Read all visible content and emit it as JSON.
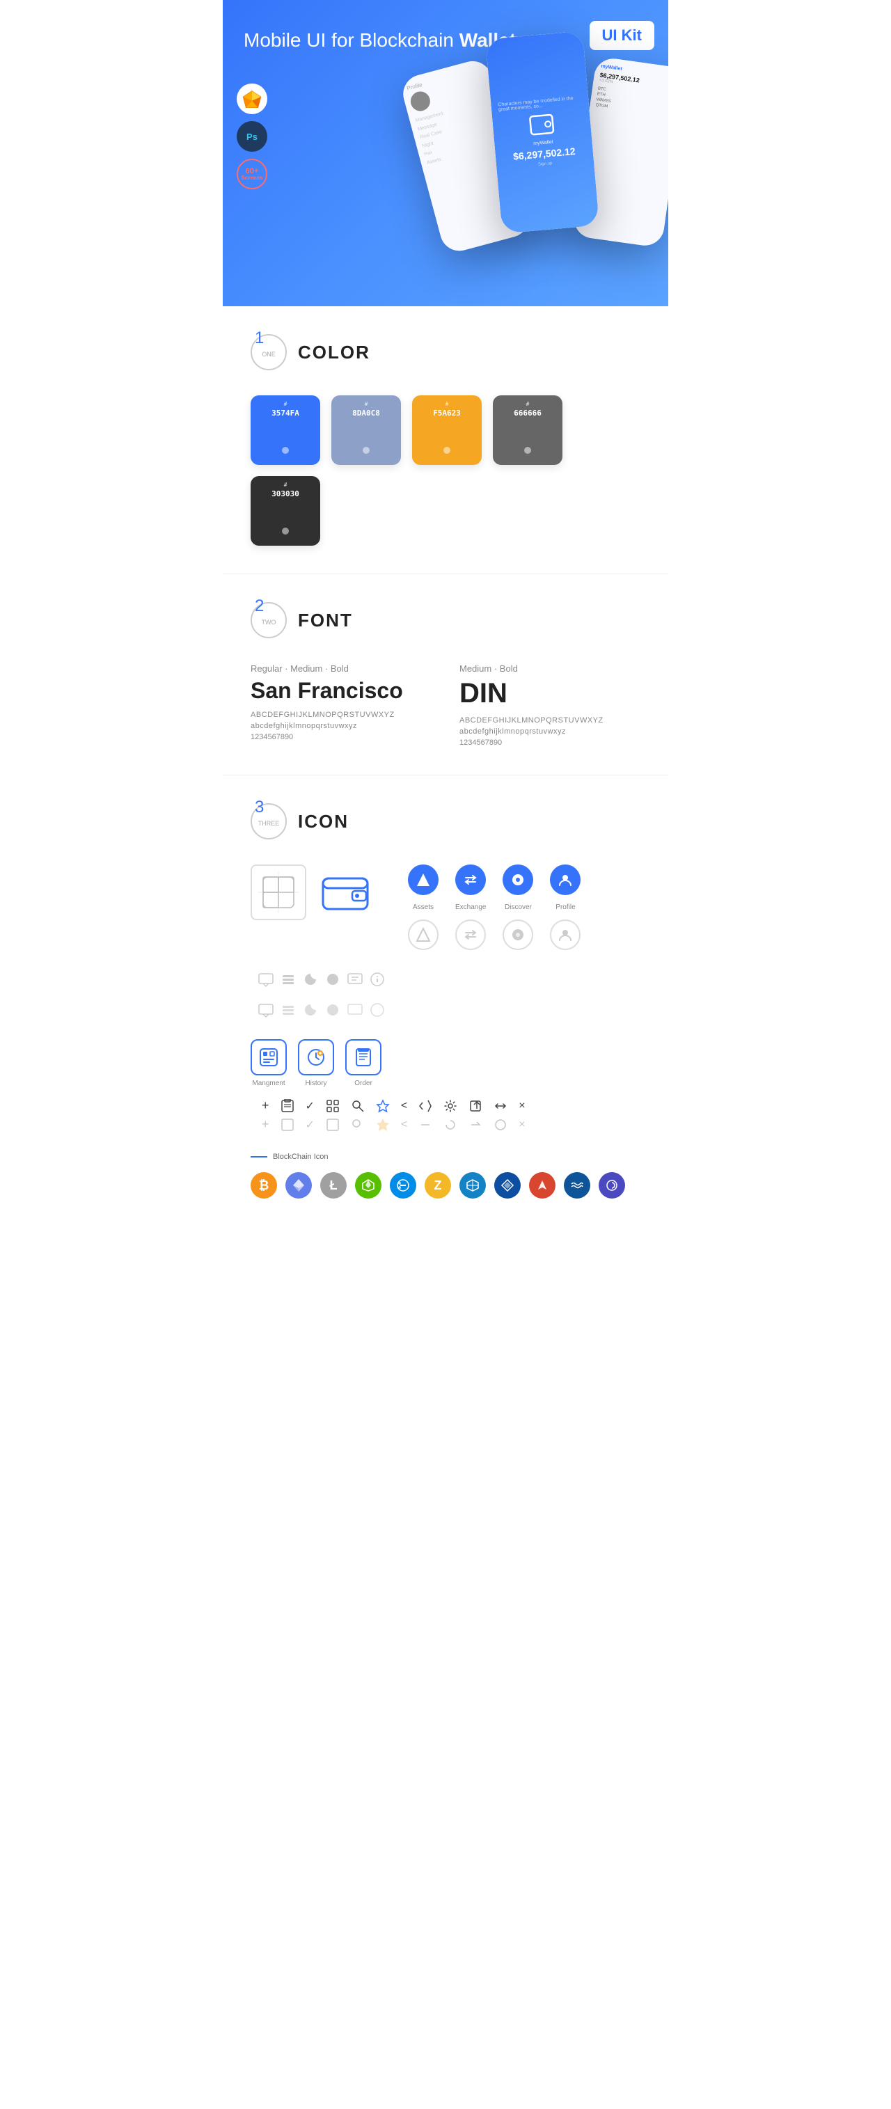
{
  "hero": {
    "title_start": "Mobile UI for Blockchain ",
    "title_bold": "Wallet",
    "badge": "UI Kit",
    "tool_sketch": "🔶",
    "tool_ps": "Ps",
    "screens_count": "60+",
    "screens_label": "Screens",
    "phone_amount": "6,297,502.12",
    "phone_wallet_label": "myWallet"
  },
  "sections": {
    "color": {
      "number": "1",
      "word": "ONE",
      "title": "COLOR",
      "swatches": [
        {
          "hex": "#3574FA",
          "code": "3574FA",
          "dark": false
        },
        {
          "hex": "#8DA0C8",
          "code": "8DA0C8",
          "dark": false
        },
        {
          "hex": "#F5A623",
          "code": "F5A623",
          "dark": false
        },
        {
          "hex": "#666666",
          "code": "666666",
          "dark": false
        },
        {
          "hex": "#303030",
          "code": "303030",
          "dark": false
        }
      ]
    },
    "font": {
      "number": "2",
      "word": "TWO",
      "title": "FONT",
      "fonts": [
        {
          "style_label": "Regular · Medium · Bold",
          "name": "San Francisco",
          "uppercase": "ABCDEFGHIJKLMNOPQRSTUVWXYZ",
          "lowercase": "abcdefghijklmnopqrstuvwxyz",
          "numbers": "1234567890"
        },
        {
          "style_label": "Medium · Bold",
          "name": "DIN",
          "uppercase": "ABCDEFGHIJKLMNOPQRSTUVWXYZ",
          "lowercase": "abcdefghijklmnopqrstuvwxyz",
          "numbers": "1234567890"
        }
      ]
    },
    "icon": {
      "number": "3",
      "word": "THREE",
      "title": "ICON",
      "colored_icons": [
        {
          "label": "Assets",
          "symbol": "◆"
        },
        {
          "label": "Exchange",
          "symbol": "⇌"
        },
        {
          "label": "Discover",
          "symbol": "●"
        },
        {
          "label": "Profile",
          "symbol": "👤"
        }
      ],
      "app_icons": [
        {
          "label": "Mangment",
          "symbol": "▦"
        },
        {
          "label": "History",
          "symbol": "🕐"
        },
        {
          "label": "Order",
          "symbol": "📋"
        }
      ],
      "small_icons_row1": [
        "+",
        "▦",
        "✓",
        "⊞",
        "🔍",
        "☆",
        "<",
        "<",
        "⚙",
        "⊡",
        "⇄",
        "×"
      ],
      "small_icons_row2": [
        "+",
        "▦",
        "✓",
        "⊞",
        "🔍",
        "☆",
        "<",
        "<",
        "⚙",
        "⊡",
        "⇄",
        "×"
      ],
      "blockchain_label": "BlockChain Icon",
      "cryptos": [
        {
          "name": "BTC",
          "class": "crypto-btc",
          "symbol": "₿"
        },
        {
          "name": "ETH",
          "class": "crypto-eth",
          "symbol": "Ξ"
        },
        {
          "name": "LTC",
          "class": "crypto-ltc",
          "symbol": "Ł"
        },
        {
          "name": "NEO",
          "class": "crypto-neo",
          "symbol": "N"
        },
        {
          "name": "DASH",
          "class": "crypto-dash",
          "symbol": "D"
        },
        {
          "name": "ZEC",
          "class": "crypto-zcash",
          "symbol": "Z"
        },
        {
          "name": "GRID",
          "class": "crypto-grid",
          "symbol": "⬡"
        },
        {
          "name": "LSK",
          "class": "crypto-lisk",
          "symbol": "△"
        },
        {
          "name": "ARK",
          "class": "crypto-ark",
          "symbol": "▲"
        },
        {
          "name": "WAV",
          "class": "crypto-waves",
          "symbol": "⌇"
        },
        {
          "name": "POLY",
          "class": "crypto-poly",
          "symbol": "∞"
        }
      ]
    }
  }
}
